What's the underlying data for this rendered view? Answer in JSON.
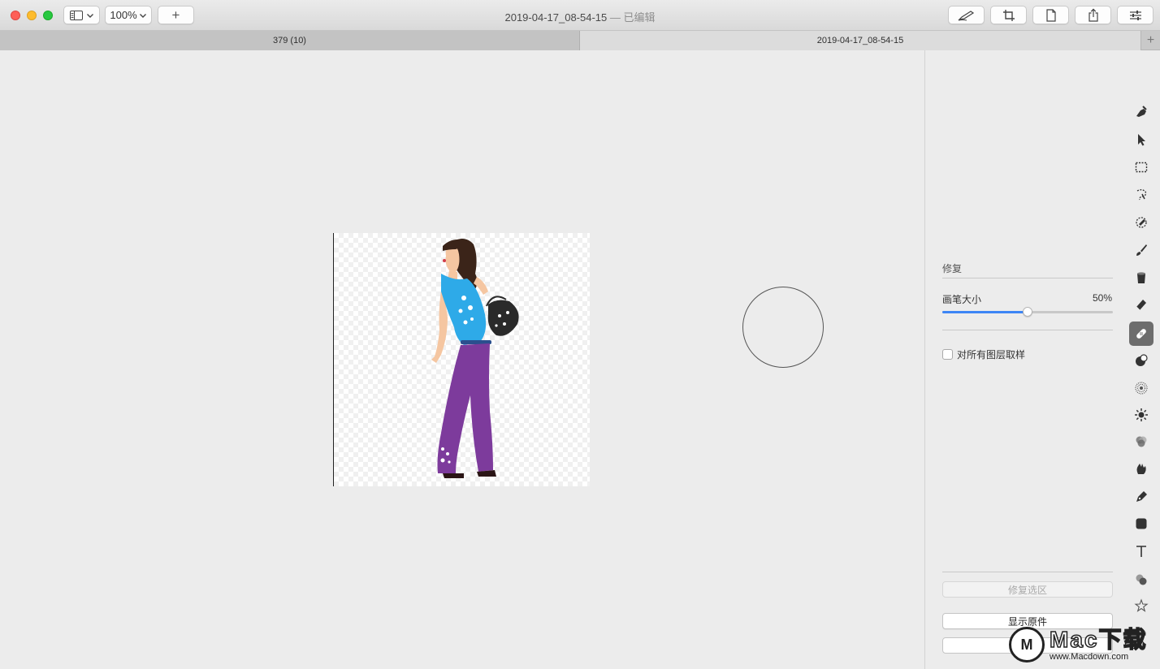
{
  "window": {
    "title": "2019-04-17_08-54-15",
    "title_status": "— 已编辑"
  },
  "toolbar": {
    "zoom": "100%",
    "add_label": "+"
  },
  "tabs": [
    {
      "label": "379 (10)"
    },
    {
      "label": "2019-04-17_08-54-15"
    }
  ],
  "tab_add_label": "+",
  "sidebar": {
    "section_title": "修复",
    "brush_size_label": "画笔大小",
    "brush_size_value": "50%",
    "brush_size_fraction": 0.5,
    "sample_all_layers_label": "对所有图层取样",
    "sample_all_layers_checked": false,
    "repair_selection_label": "修复选区",
    "show_original_label": "显示原件"
  },
  "tools": [
    "color-adjust-icon",
    "arrow-select-icon",
    "rect-select-icon",
    "lasso-select-icon",
    "magic-select-icon",
    "brush-icon",
    "bucket-icon",
    "eraser-icon",
    "bandage-heal-icon",
    "clone-icon",
    "blur-icon",
    "sharpen-icon",
    "color-blend-icon",
    "smudge-icon",
    "pen-icon",
    "shape-icon",
    "text-icon",
    "effects-icon",
    "star-icon"
  ],
  "watermark": {
    "logo": "M",
    "big": "Mac下载",
    "small": "www.Macdown.com"
  },
  "colors": {
    "accent": "#3d85f5",
    "close": "#fe5f57",
    "minimize": "#febc2e",
    "maximize": "#28c840"
  }
}
